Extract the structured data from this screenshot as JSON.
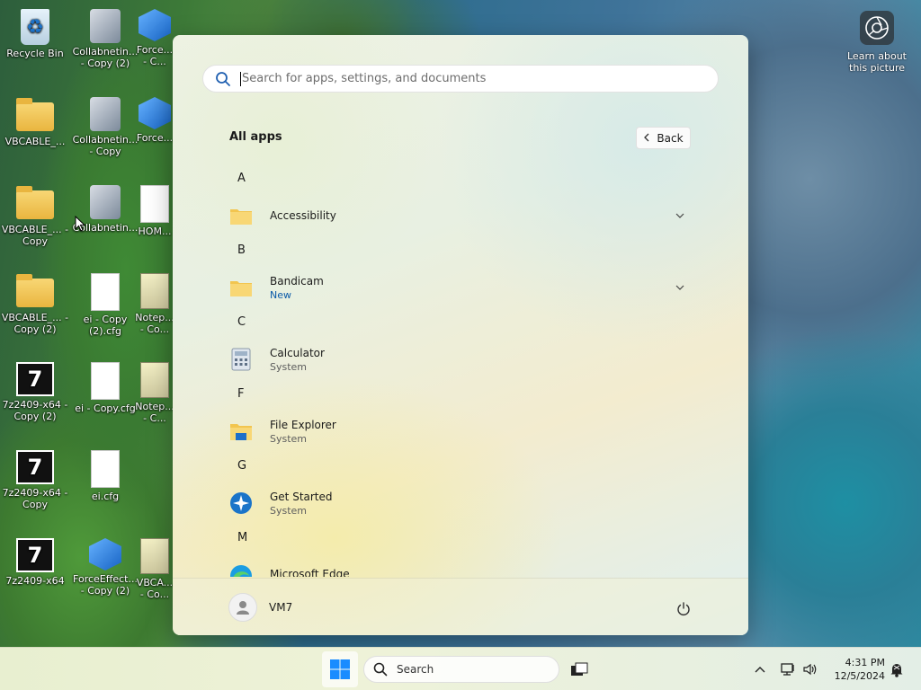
{
  "desktop": {
    "icons": [
      {
        "label": "Recycle Bin",
        "icon": "recycle-bin-icon"
      },
      {
        "label": "Collabnetin... - Copy (2)",
        "icon": "network-computer-icon"
      },
      {
        "label": "Force... - C...",
        "icon": "cube-app-icon"
      },
      {
        "label": "VBCABLE_...",
        "icon": "folder-icon"
      },
      {
        "label": "Collabnetin... - Copy",
        "icon": "network-computer-icon"
      },
      {
        "label": "Force...",
        "icon": "cube-app-icon"
      },
      {
        "label": "VBCABLE_... - Copy",
        "icon": "folder-icon"
      },
      {
        "label": "Collabnetin...",
        "icon": "network-computer-icon"
      },
      {
        "label": "HOM...",
        "icon": "file-icon"
      },
      {
        "label": "VBCABLE_... - Copy (2)",
        "icon": "folder-icon"
      },
      {
        "label": "ei - Copy (2).cfg",
        "icon": "file-icon"
      },
      {
        "label": "Notep... - Co...",
        "icon": "notepad-icon"
      },
      {
        "label": "7z2409-x64 - Copy (2)",
        "icon": "7zip-installer-icon"
      },
      {
        "label": "ei - Copy.cfg",
        "icon": "file-icon"
      },
      {
        "label": "Notep... - C...",
        "icon": "notepad-icon"
      },
      {
        "label": "7z2409-x64 - Copy",
        "icon": "7zip-installer-icon"
      },
      {
        "label": "ei.cfg",
        "icon": "file-icon"
      },
      {
        "label": "7z2409-x64",
        "icon": "7zip-installer-icon"
      },
      {
        "label": "ForceEffect... - Copy (2)",
        "icon": "cube-app-icon"
      },
      {
        "label": "VBCA... - Co...",
        "icon": "notepad-icon"
      }
    ],
    "learn_about_picture": "Learn about this picture"
  },
  "start_menu": {
    "search_placeholder": "Search for apps, settings, and documents",
    "section_title": "All apps",
    "back_label": "Back",
    "groups": [
      {
        "letter": "A",
        "apps": [
          {
            "name": "Accessibility",
            "sub": "",
            "icon": "folder-icon",
            "expandable": true
          }
        ]
      },
      {
        "letter": "B",
        "apps": [
          {
            "name": "Bandicam",
            "sub": "New",
            "icon": "folder-icon",
            "expandable": true
          }
        ]
      },
      {
        "letter": "C",
        "apps": [
          {
            "name": "Calculator",
            "sub": "System",
            "icon": "calculator-icon",
            "expandable": false
          }
        ]
      },
      {
        "letter": "F",
        "apps": [
          {
            "name": "File Explorer",
            "sub": "System",
            "icon": "file-explorer-icon",
            "expandable": false
          }
        ]
      },
      {
        "letter": "G",
        "apps": [
          {
            "name": "Get Started",
            "sub": "System",
            "icon": "get-started-icon",
            "expandable": false
          }
        ]
      },
      {
        "letter": "M",
        "apps": [
          {
            "name": "Microsoft Edge",
            "sub": "",
            "icon": "edge-icon",
            "expandable": false
          }
        ]
      }
    ],
    "user_name": "VM7"
  },
  "taskbar": {
    "search_label": "Search",
    "clock_time": "4:31 PM",
    "clock_date": "12/5/2024"
  },
  "colors": {
    "accent": "#0067c0",
    "new_badge": "#0a5aa8",
    "folder": "#f2c54f"
  }
}
